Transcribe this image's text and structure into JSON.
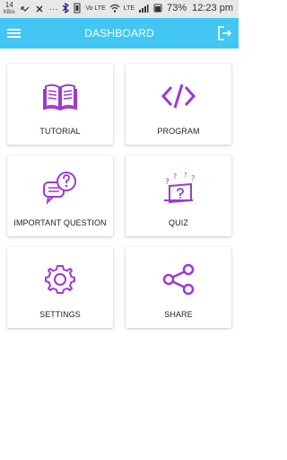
{
  "status_bar": {
    "left_speed": "14",
    "left_unit": "KB/s",
    "volte1": "Vo LTE",
    "volte2": "LTE",
    "battery_percent": "73%",
    "time": "12:23 pm",
    "icons": [
      "speed-indicator",
      "missed-call-icon",
      "mute-icon",
      "more-icon",
      "bluetooth-icon",
      "vibrate-icon",
      "wifi-icon",
      "signal-icon",
      "battery-icon"
    ]
  },
  "app_bar": {
    "title": "DASHBOARD",
    "menu_icon": "hamburger-menu-icon",
    "logout_icon": "logout-icon",
    "color": "#42c6f3"
  },
  "dashboard": {
    "accent": "#9c3ad0",
    "items": [
      {
        "label": "TUTORIAL",
        "icon": "book-icon"
      },
      {
        "label": "PROGRAM",
        "icon": "code-icon"
      },
      {
        "label": "IMPORTANT QUESTION",
        "icon": "question-chat-icon"
      },
      {
        "label": "QUIZ",
        "icon": "quiz-icon"
      },
      {
        "label": "SETTINGS",
        "icon": "settings-gear-icon"
      },
      {
        "label": "SHARE",
        "icon": "share-icon"
      }
    ]
  }
}
